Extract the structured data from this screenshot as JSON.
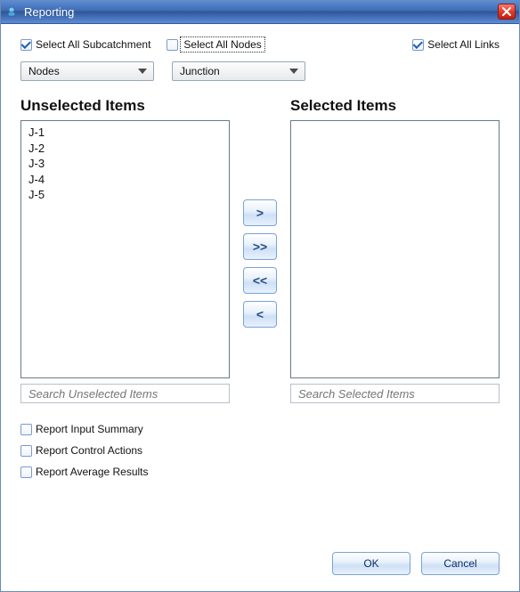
{
  "window": {
    "title": "Reporting"
  },
  "checkboxes": {
    "select_all_subcatchment": {
      "label": "Select All Subcatchment",
      "checked": true
    },
    "select_all_nodes": {
      "label": "Select All Nodes",
      "checked": false,
      "focused": true
    },
    "select_all_links": {
      "label": "Select All Links",
      "checked": true
    }
  },
  "dropdowns": {
    "category": {
      "value": "Nodes"
    },
    "subtype": {
      "value": "Junction"
    }
  },
  "lists": {
    "unselected": {
      "header": "Unselected Items",
      "items": [
        "J-1",
        "J-2",
        "J-3",
        "J-4",
        "J-5"
      ],
      "search_placeholder": "Search Unselected Items"
    },
    "selected": {
      "header": "Selected Items",
      "items": [],
      "search_placeholder": "Search Selected Items"
    }
  },
  "move_buttons": {
    "move_right": ">",
    "move_all_right": ">>",
    "move_all_left": "<<",
    "move_left": "<"
  },
  "report_options": {
    "input_summary": {
      "label": "Report Input Summary",
      "checked": false
    },
    "control_actions": {
      "label": "Report Control Actions",
      "checked": false
    },
    "average_results": {
      "label": "Report Average Results",
      "checked": false
    }
  },
  "footer": {
    "ok": "OK",
    "cancel": "Cancel"
  }
}
